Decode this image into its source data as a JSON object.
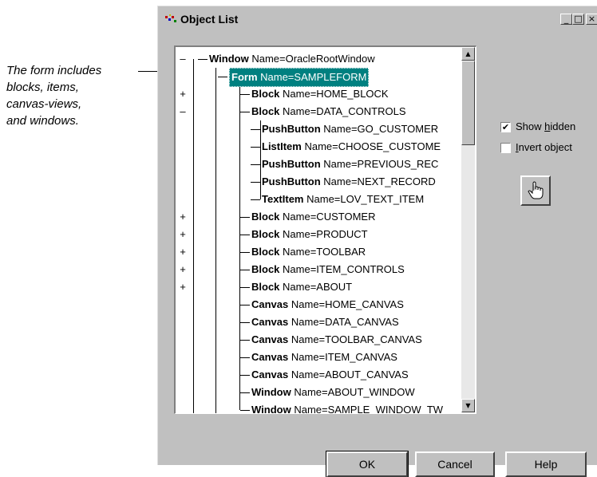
{
  "annotation": {
    "lines": [
      "The form includes",
      "blocks, items,",
      "canvas-views,",
      "and windows."
    ]
  },
  "window": {
    "title": "Object List",
    "controls": {
      "minimize": "_",
      "maximize": "□",
      "close": "×"
    }
  },
  "tree": {
    "items": [
      {
        "expander": "–",
        "type": "Window",
        "name": "Name=OracleRootWindow",
        "level": 0
      },
      {
        "expander": "",
        "type": "Form",
        "name": "Name=SAMPLEFORM",
        "level": 1,
        "selected": true
      },
      {
        "expander": "+",
        "type": "Block",
        "name": "Name=HOME_BLOCK",
        "level": 2
      },
      {
        "expander": "–",
        "type": "Block",
        "name": "Name=DATA_CONTROLS",
        "level": 2
      },
      {
        "expander": "",
        "type": "PushButton",
        "name": "Name=GO_CUSTOMER",
        "level": 3
      },
      {
        "expander": "",
        "type": "ListItem",
        "name": "Name=CHOOSE_CUSTOME",
        "level": 3
      },
      {
        "expander": "",
        "type": "PushButton",
        "name": "Name=PREVIOUS_REC",
        "level": 3
      },
      {
        "expander": "",
        "type": "PushButton",
        "name": "Name=NEXT_RECORD",
        "level": 3
      },
      {
        "expander": "",
        "type": "TextItem",
        "name": "Name=LOV_TEXT_ITEM",
        "level": 3
      },
      {
        "expander": "+",
        "type": "Block",
        "name": "Name=CUSTOMER",
        "level": 2
      },
      {
        "expander": "+",
        "type": "Block",
        "name": "Name=PRODUCT",
        "level": 2
      },
      {
        "expander": "+",
        "type": "Block",
        "name": "Name=TOOLBAR",
        "level": 2
      },
      {
        "expander": "+",
        "type": "Block",
        "name": "Name=ITEM_CONTROLS",
        "level": 2
      },
      {
        "expander": "+",
        "type": "Block",
        "name": "Name=ABOUT",
        "level": 2
      },
      {
        "expander": "",
        "type": "Canvas",
        "name": "Name=HOME_CANVAS",
        "level": 2
      },
      {
        "expander": "",
        "type": "Canvas",
        "name": "Name=DATA_CANVAS",
        "level": 2
      },
      {
        "expander": "",
        "type": "Canvas",
        "name": "Name=TOOLBAR_CANVAS",
        "level": 2
      },
      {
        "expander": "",
        "type": "Canvas",
        "name": "Name=ITEM_CANVAS",
        "level": 2
      },
      {
        "expander": "",
        "type": "Canvas",
        "name": "Name=ABOUT_CANVAS",
        "level": 2
      },
      {
        "expander": "",
        "type": "Window",
        "name": "Name=ABOUT_WINDOW",
        "level": 2
      },
      {
        "expander": "",
        "type": "Window",
        "name": "Name=SAMPLE_WINDOW_TW",
        "level": 2
      }
    ],
    "scroll": {
      "up": "▲",
      "down": "▼"
    }
  },
  "options": {
    "show_hidden": {
      "prefix": "Show ",
      "accel": "h",
      "suffix": "idden",
      "checked": true,
      "check_glyph": "✔"
    },
    "invert_object": {
      "prefix": "",
      "accel": "I",
      "suffix": "nvert object",
      "checked": false,
      "check_glyph": ""
    }
  },
  "hand_button": {
    "icon": "hand-pointer-icon"
  },
  "buttons": {
    "ok": "OK",
    "cancel": "Cancel",
    "help": "Help"
  },
  "colors": {
    "selection": "#008080",
    "face": "#c0c0c0"
  }
}
